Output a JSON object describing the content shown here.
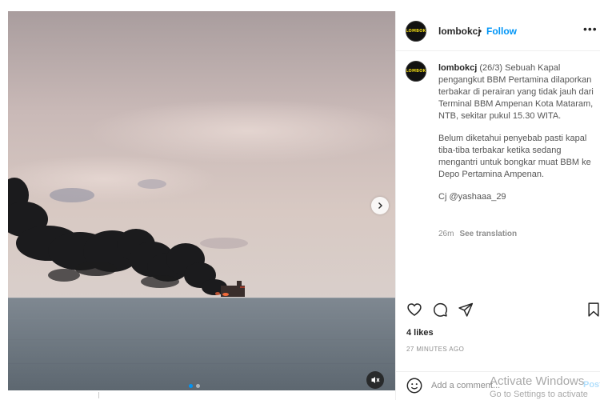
{
  "post": {
    "username": "lombokcj",
    "separator": "•",
    "follow_label": "Follow",
    "more_label": "•••",
    "avatar_logo_text": "LOMBOK",
    "caption_user": "lombokcj",
    "caption_paragraph_1": "(26/3) Sebuah Kapal pengangkut BBM Pertamina dilaporkan terbakar di perairan yang tidak jauh dari Terminal BBM Ampenan Kota Mataram, NTB, sekitar pukul 15.30 WITA.",
    "caption_paragraph_2": "Belum diketahui penyebab pasti kapal tiba-tiba terbakar ketika sedang mengantri untuk bongkar muat BBM ke Depo Pertamina Ampenan.",
    "caption_credit": "Cj @yashaaa_29",
    "time_short": "26m",
    "see_translation_label": "See translation",
    "likes_label": "4 likes",
    "time_long": "27 MINUTES AGO"
  },
  "comment": {
    "placeholder": "Add a comment...",
    "post_label": "Post"
  },
  "media": {
    "carousel_total": 2,
    "carousel_current": 1,
    "icons": [
      "chevron-right-icon",
      "mute-icon"
    ]
  },
  "icons": {
    "like": "heart-icon",
    "comment": "comment-icon",
    "share": "share-icon",
    "save": "bookmark-icon",
    "emoji": "emoji-icon"
  },
  "os_watermark": {
    "line1": "Activate Windows",
    "line2": "Go to Settings to activate"
  },
  "colors": {
    "accent": "#0095f6",
    "logo": "#e8d313",
    "text": "#262626",
    "muted": "#8e8e8e"
  }
}
